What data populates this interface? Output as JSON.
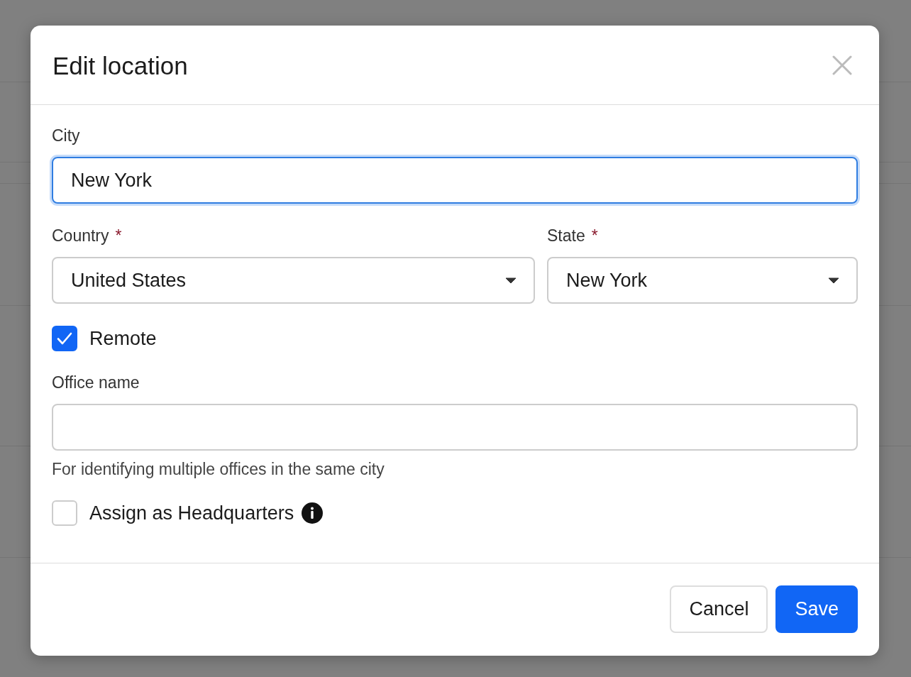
{
  "dialog": {
    "title": "Edit location"
  },
  "city": {
    "label": "City",
    "value": "New York",
    "focused": true
  },
  "country": {
    "label": "Country",
    "required_mark": "*",
    "value": "United States"
  },
  "state": {
    "label": "State",
    "required_mark": "*",
    "value": "New York"
  },
  "remote": {
    "label": "Remote",
    "checked": true
  },
  "office_name": {
    "label": "Office name",
    "helper": "For identifying multiple offices in the same city"
  },
  "headquarters": {
    "label": "Assign as Headquarters",
    "checked": false
  },
  "buttons": [
    {
      "label": "Cancel",
      "kind": "secondary"
    },
    {
      "label": "Save",
      "kind": "primary"
    }
  ]
}
